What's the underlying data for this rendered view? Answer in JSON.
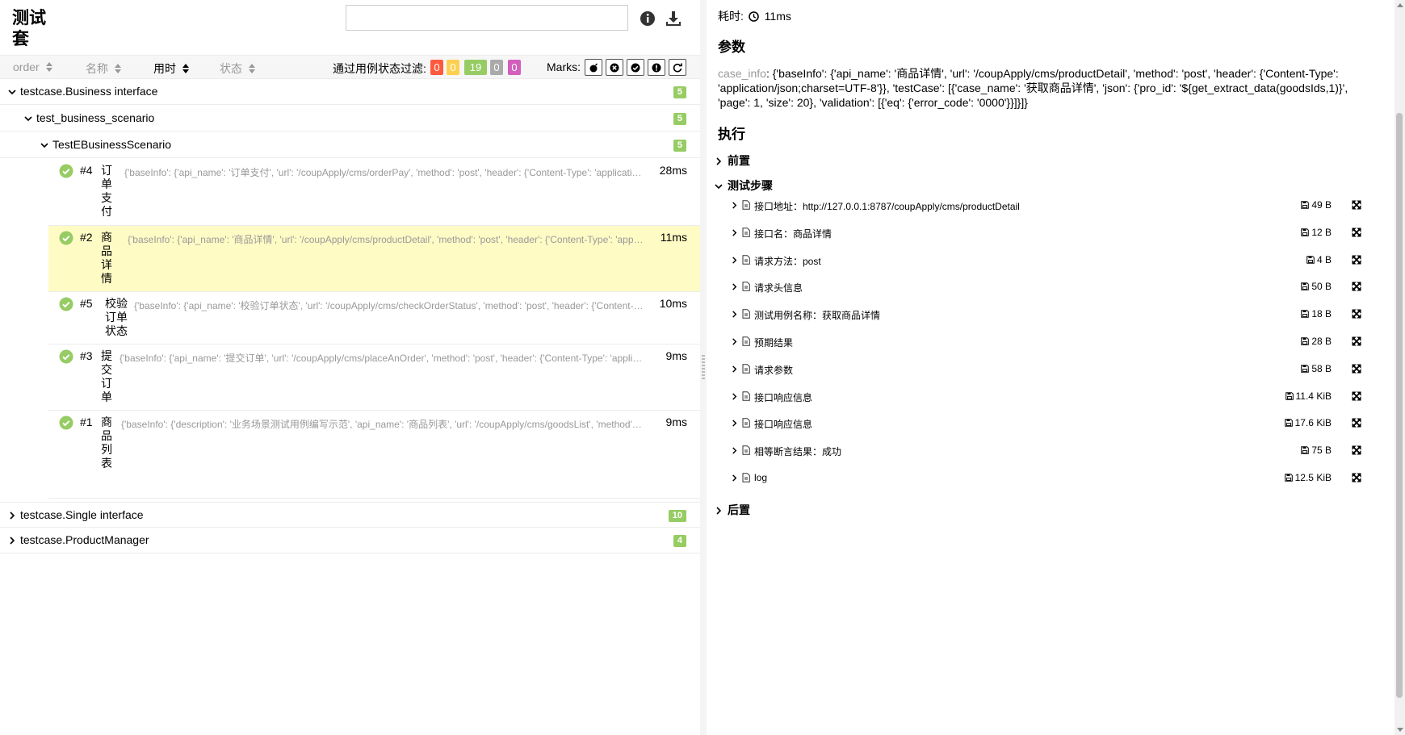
{
  "colors": {
    "passed": "#97cc64",
    "failed": "#fd5a3e",
    "broken": "#ffd050",
    "skipped": "#aaaaaa",
    "unknown": "#d35ebe",
    "selected_row": "#fffbc5"
  },
  "header": {
    "title": "测试套",
    "search": {
      "value": "",
      "placeholder": ""
    },
    "icons": [
      "info-icon",
      "download-icon"
    ]
  },
  "sortbar": {
    "columns": [
      {
        "label": "order",
        "active": false
      },
      {
        "label": "名称",
        "active": false
      },
      {
        "label": "用时",
        "active": true
      },
      {
        "label": "状态",
        "active": false
      }
    ],
    "filter_label": "通过用例状态过滤:",
    "filters": [
      {
        "count": "0",
        "status": "failed"
      },
      {
        "count": "0",
        "status": "broken"
      },
      {
        "count": "19",
        "status": "passed"
      },
      {
        "count": "0",
        "status": "skipped"
      },
      {
        "count": "0",
        "status": "unknown"
      }
    ],
    "marks_label": "Marks:",
    "marks": [
      "flaky-bomb-icon",
      "new-failed-icon",
      "new-passed-icon",
      "new-broken-icon",
      "retries-icon"
    ]
  },
  "tree": {
    "groups": [
      {
        "label": "testcase.Business interface",
        "count": "5",
        "expanded": true
      },
      {
        "label": "test_business_scenario",
        "count": "5",
        "expanded": true
      },
      {
        "label": "TestEBusinessScenario",
        "count": "5",
        "expanded": true
      }
    ],
    "cases": [
      {
        "num": "#4",
        "name": "订\n单\n支\n付",
        "desc": "{'baseInfo': {'api_name': '订单支付', 'url': '/coupApply/cms/orderPay', 'method': 'post', 'header': {'Content-Type': 'application/json;charset=UTF-8'}}",
        "duration": "28ms",
        "selected": false
      },
      {
        "num": "#2",
        "name": "商\n品\n详\n情",
        "desc": "{'baseInfo': {'api_name': '商品详情', 'url': '/coupApply/cms/productDetail', 'method': 'post', 'header': {'Content-Type': 'application/json;charset=UTF-8'}}",
        "duration": "11ms",
        "selected": true
      },
      {
        "num": "#5",
        "name": "校验\n订单\n状态",
        "desc": "{'baseInfo': {'api_name': '校验订单状态', 'url': '/coupApply/cms/checkOrderStatus', 'method': 'post', 'header': {'Content-Type': 'application/json;charset=UTF-8'}}",
        "duration": "10ms",
        "selected": false
      },
      {
        "num": "#3",
        "name": "提\n交\n订\n单",
        "desc": "{'baseInfo': {'api_name': '提交订单', 'url': '/coupApply/cms/placeAnOrder', 'method': 'post', 'header': {'Content-Type': 'application/json;charset=UTF-8'}}",
        "duration": "9ms",
        "selected": false
      },
      {
        "num": "#1",
        "name": "商\n品\n列\n表",
        "desc": "{'baseInfo': {'description': '业务场景测试用例编写示范', 'api_name': '商品列表', 'url': '/coupApply/cms/goodsList', 'method': 'Get', 'header': {}}",
        "duration": "9ms",
        "selected": false
      }
    ],
    "collapsed_groups": [
      {
        "label": "testcase.Single interface",
        "count": "10"
      },
      {
        "label": "testcase.ProductManager",
        "count": "4"
      }
    ]
  },
  "detail": {
    "duration_label": "耗时:",
    "duration_value": "11ms",
    "params_title": "参数",
    "param_key": "case_info",
    "param_value": ": {'baseInfo': {'api_name': '商品详情', 'url': '/coupApply/cms/productDetail', 'method': 'post', 'header': {'Content-Type': 'application/json;charset=UTF-8'}}, 'testCase': [{'case_name': '获取商品详情', 'json': {'pro_id': '${get_extract_data(goodsIds,1)}', 'page': 1, 'size': 20}, 'validation': [{'eq': {'error_code': '0000'}}]}]}",
    "exec_title": "执行",
    "setup_label": "前置",
    "steps_label": "测试步骤",
    "teardown_label": "后置",
    "steps": [
      {
        "label": "接口地址：http://127.0.0.1:8787/coupApply/cms/productDetail",
        "size": "49 B"
      },
      {
        "label": "接口名：商品详情",
        "size": "12 B"
      },
      {
        "label": "请求方法：post",
        "size": "4 B"
      },
      {
        "label": "请求头信息",
        "size": "50 B"
      },
      {
        "label": "测试用例名称：获取商品详情",
        "size": "18 B"
      },
      {
        "label": "预期结果",
        "size": "28 B"
      },
      {
        "label": "请求参数",
        "size": "58 B"
      },
      {
        "label": "接口响应信息",
        "size": "11.4 KiB"
      },
      {
        "label": "接口响应信息",
        "size": "17.6 KiB"
      },
      {
        "label": "相等断言结果：成功",
        "size": "75 B"
      },
      {
        "label": "log",
        "size": "12.5 KiB"
      }
    ]
  }
}
